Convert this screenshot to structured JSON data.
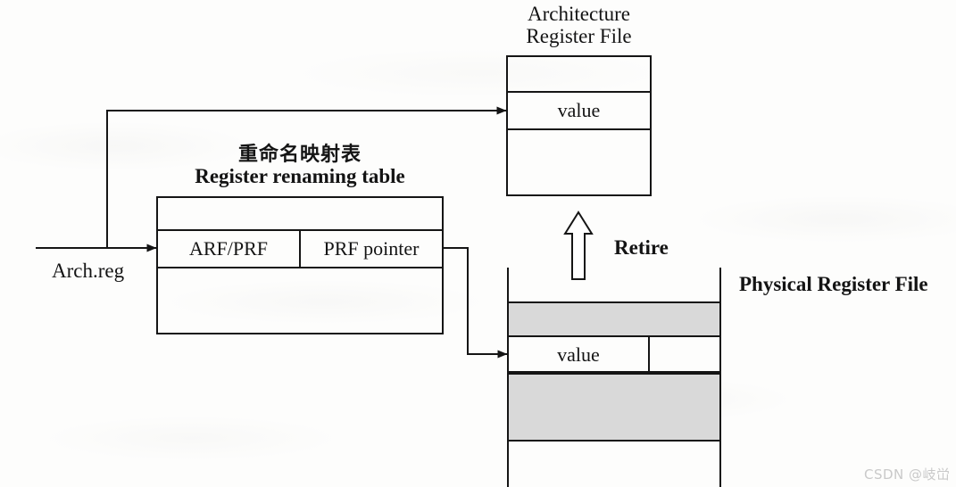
{
  "diagram": {
    "title_cn": "重命名映射表",
    "title_en": "Register renaming table",
    "arch_file_title_line1": "Architecture",
    "arch_file_title_line2": "Register File",
    "physical_file_title": "Physical Register File",
    "arch_value_cell": "value",
    "physical_value_cell": "value",
    "table_cell_left": "ARF/PRF",
    "table_cell_right": "PRF pointer",
    "input_label": "Arch.reg",
    "retire_label": "Retire",
    "colors": {
      "ink": "#151515",
      "gray_row": "#d9d9d9",
      "paper": "#fdfdfc",
      "watermark": "#c9c9c9"
    }
  },
  "watermark": {
    "text": "CSDN @岐峃"
  }
}
